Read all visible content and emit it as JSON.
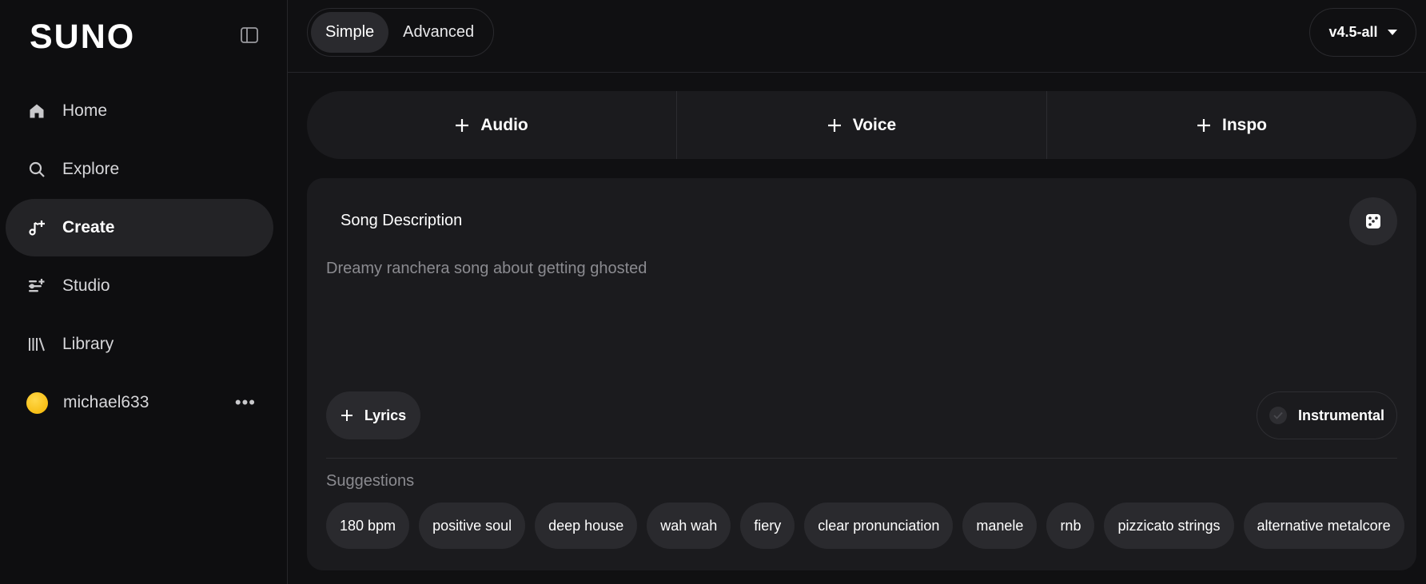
{
  "sidebar": {
    "brand": "SUNO",
    "items": [
      {
        "label": "Home",
        "icon": "home-icon"
      },
      {
        "label": "Explore",
        "icon": "search-icon"
      },
      {
        "label": "Create",
        "icon": "music-note-plus-icon",
        "active": true
      },
      {
        "label": "Studio",
        "icon": "studio-sliders-icon"
      },
      {
        "label": "Library",
        "icon": "library-icon"
      }
    ],
    "user": {
      "name": "michael633",
      "more": "•••"
    }
  },
  "topbar": {
    "modes": [
      "Simple",
      "Advanced"
    ],
    "active_mode": "Simple",
    "version": "v4.5-all"
  },
  "add_row": [
    "Audio",
    "Voice",
    "Inspo"
  ],
  "panel": {
    "title": "Song Description",
    "placeholder": "Dreamy ranchera song about getting ghosted",
    "value": "",
    "lyrics_label": "Lyrics",
    "instrumental_label": "Instrumental",
    "suggestions_label": "Suggestions",
    "suggestions": [
      "180 bpm",
      "positive soul",
      "deep house",
      "wah wah",
      "fiery",
      "clear pronunciation",
      "manele",
      "rnb",
      "pizzicato strings",
      "alternative metalcore"
    ]
  },
  "colors": {
    "background": "#101012",
    "surface": "#1b1b1e",
    "chip": "#2a2a2e",
    "muted_text": "#8b8b90",
    "avatar": "#f4b400"
  }
}
